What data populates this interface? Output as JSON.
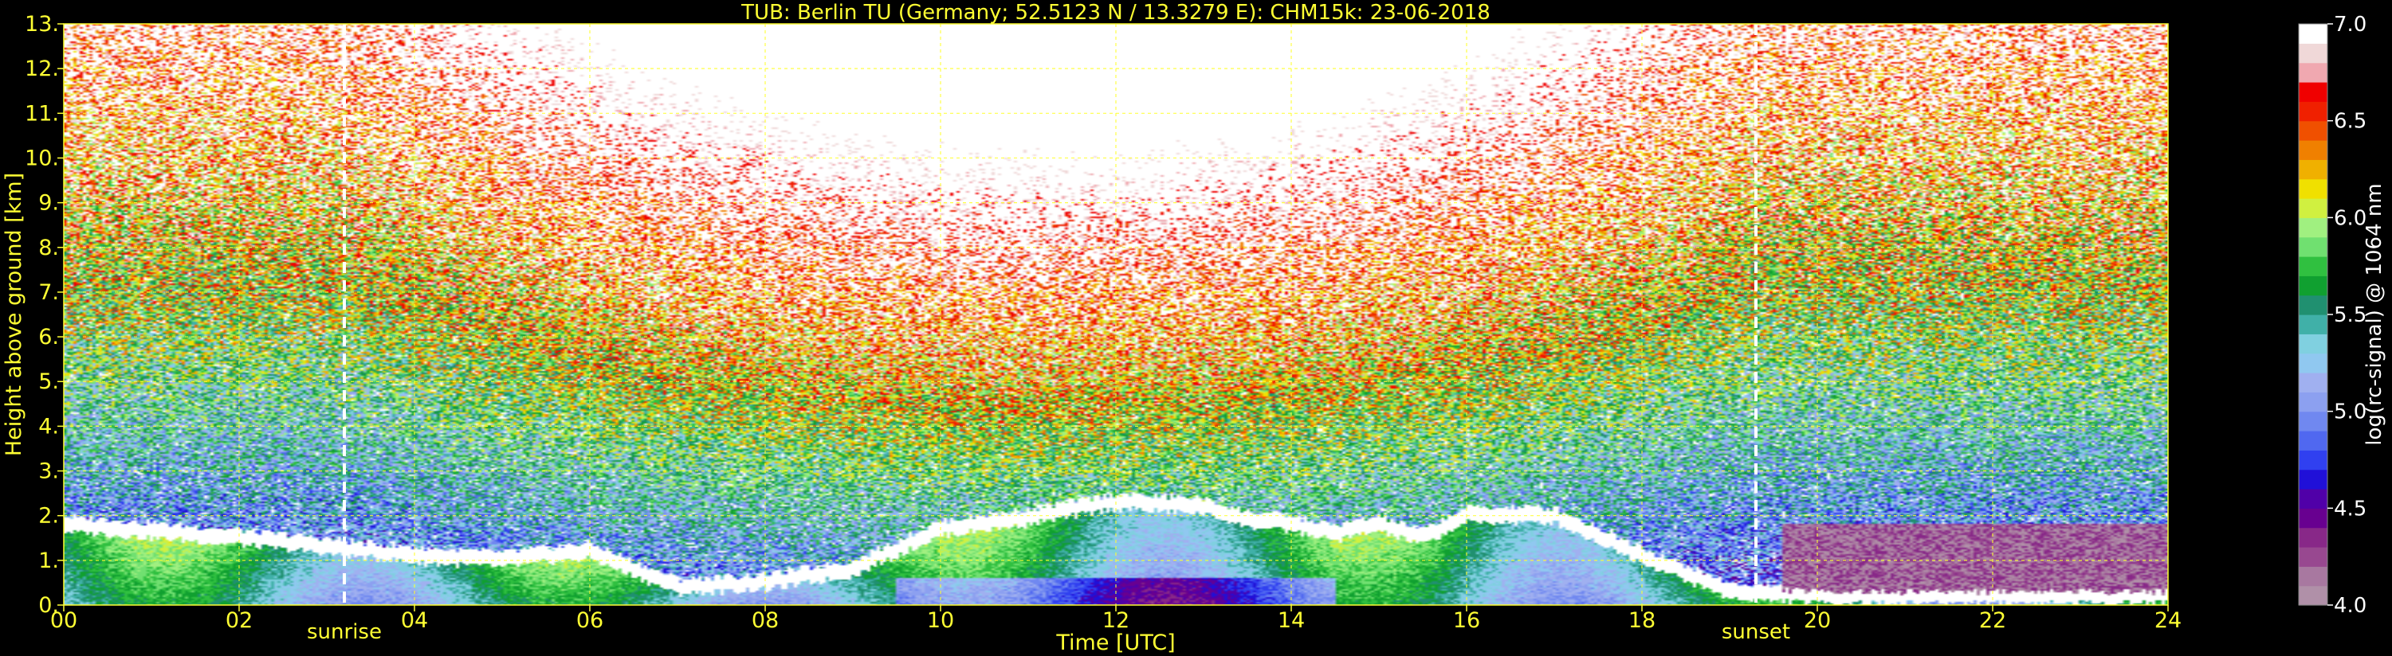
{
  "chart_data": {
    "type": "heatmap",
    "title": "TUB: Berlin TU (Germany; 52.5123 N / 13.3279 E):    CHM15k: 23-06-2018",
    "xlabel": "Time [UTC]",
    "ylabel": "Height above ground [km]",
    "xlim": [
      0,
      24
    ],
    "ylim": [
      0,
      13
    ],
    "x_ticks": [
      "00",
      "02",
      "04",
      "06",
      "08",
      "10",
      "12",
      "14",
      "16",
      "18",
      "20",
      "22",
      "24"
    ],
    "y_ticks": [
      "0.",
      "1.",
      "2.",
      "3.",
      "4.",
      "5.",
      "6.",
      "7.",
      "8.",
      "9.",
      "10.",
      "11.",
      "12.",
      "13."
    ],
    "grid": true,
    "colorbar": {
      "label": "log(rc-signal) @ 1064 nm",
      "range": [
        4.0,
        7.0
      ],
      "ticks": [
        "4.0",
        "4.5",
        "5.0",
        "5.5",
        "6.0",
        "6.5",
        "7.0"
      ],
      "colors": [
        "#b090a8",
        "#a878a0",
        "#984890",
        "#882888",
        "#680090",
        "#5000a8",
        "#2010d8",
        "#3040f0",
        "#5068f0",
        "#7088f0",
        "#8ca0f0",
        "#a0b0f0",
        "#90c8f0",
        "#80d0e0",
        "#40b0a8",
        "#209070",
        "#10a030",
        "#30c040",
        "#70e070",
        "#a0f080",
        "#d0f040",
        "#f0e000",
        "#f0b000",
        "#f08000",
        "#f05000",
        "#f02000",
        "#f00000",
        "#f0a8b0",
        "#f0d8d8",
        "#ffffff"
      ]
    },
    "events": [
      {
        "label": "sunrise",
        "time": 3.2
      },
      {
        "label": "sunset",
        "time": 19.3
      }
    ],
    "boundary_layer_top_km": [
      [
        0.0,
        1.9
      ],
      [
        1.0,
        1.75
      ],
      [
        2.0,
        1.6
      ],
      [
        2.5,
        1.5
      ],
      [
        3.0,
        1.4
      ],
      [
        4.0,
        1.2
      ],
      [
        5.0,
        1.1
      ],
      [
        6.0,
        1.3
      ],
      [
        6.5,
        0.9
      ],
      [
        7.0,
        0.5
      ],
      [
        8.0,
        0.6
      ],
      [
        9.0,
        0.9
      ],
      [
        10.0,
        1.8
      ],
      [
        11.0,
        2.05
      ],
      [
        12.0,
        2.4
      ],
      [
        13.0,
        2.3
      ],
      [
        13.5,
        2.0
      ],
      [
        14.0,
        1.9
      ],
      [
        14.5,
        1.7
      ],
      [
        15.0,
        1.9
      ],
      [
        15.5,
        1.6
      ],
      [
        16.0,
        2.1
      ],
      [
        17.0,
        2.1
      ],
      [
        18.0,
        1.2
      ],
      [
        19.0,
        0.4
      ],
      [
        20.0,
        0.3
      ],
      [
        22.0,
        0.3
      ],
      [
        24.0,
        0.3
      ]
    ]
  }
}
